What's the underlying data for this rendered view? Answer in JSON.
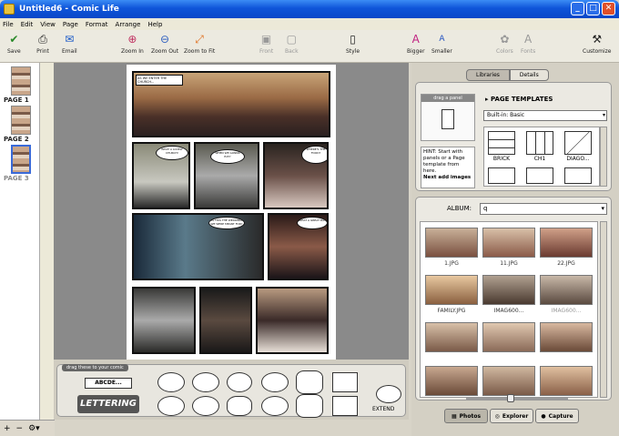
{
  "window": {
    "title": "Untitled6 - Comic Life",
    "min": "_",
    "max": "□",
    "close": "✕"
  },
  "menu": [
    "File",
    "Edit",
    "View",
    "Page",
    "Format",
    "Arrange",
    "Help"
  ],
  "toolbar": {
    "save": "Save",
    "print": "Print",
    "email": "Email",
    "zoom_in": "Zoom In",
    "zoom_out": "Zoom Out",
    "zoom_fit": "Zoom to Fit",
    "front": "Front",
    "back": "Back",
    "style": "Style",
    "bigger": "Bigger",
    "smaller": "Smaller",
    "colors": "Colors",
    "fonts": "Fonts",
    "customize": "Customize"
  },
  "pages": [
    "PAGE 1",
    "PAGE 2",
    "PAGE 3"
  ],
  "comic": {
    "caption": "AS WE ENTER THE CHURCH...",
    "bubbles": [
      "WHAT A LOVELY CHURCH!",
      "WHEN WE GONNA EAT?",
      "WHERE'S THE FOOD?",
      "IS THIS THE WEDDING WE WERE MEANT FOR?",
      "WHAT A GREAT DAY",
      "THAT WAS EASY"
    ]
  },
  "lib": {
    "drag_tag": "drag these to your comic",
    "abcde": "ABCDE...",
    "lettering": "LETTERING",
    "extend": "EXTEND"
  },
  "right": {
    "tab_libraries": "Libraries",
    "tab_details": "Details",
    "drag_panel": "drag a panel",
    "page_templates": "PAGE TEMPLATES",
    "builtin": "Built-in: Basic",
    "hint": "HINT: Start with panels or a Page template from here.",
    "hint2": "Next add images",
    "templates": [
      "BRICK",
      "CH1",
      "DIAGO..."
    ],
    "album_label": "ALBUM:",
    "album_value": "q",
    "photos": [
      "1.JPG",
      "11.JPG",
      "22.JPG",
      "FAMILY.JPG",
      "IMAG600...",
      "IMAG600...",
      "",
      "",
      ""
    ],
    "tab_photos": "Photos",
    "tab_explorer": "Explorer",
    "tab_capture": "Capture"
  },
  "colors": {
    "accent": "#0a47c8",
    "paper": "#ffffff"
  }
}
